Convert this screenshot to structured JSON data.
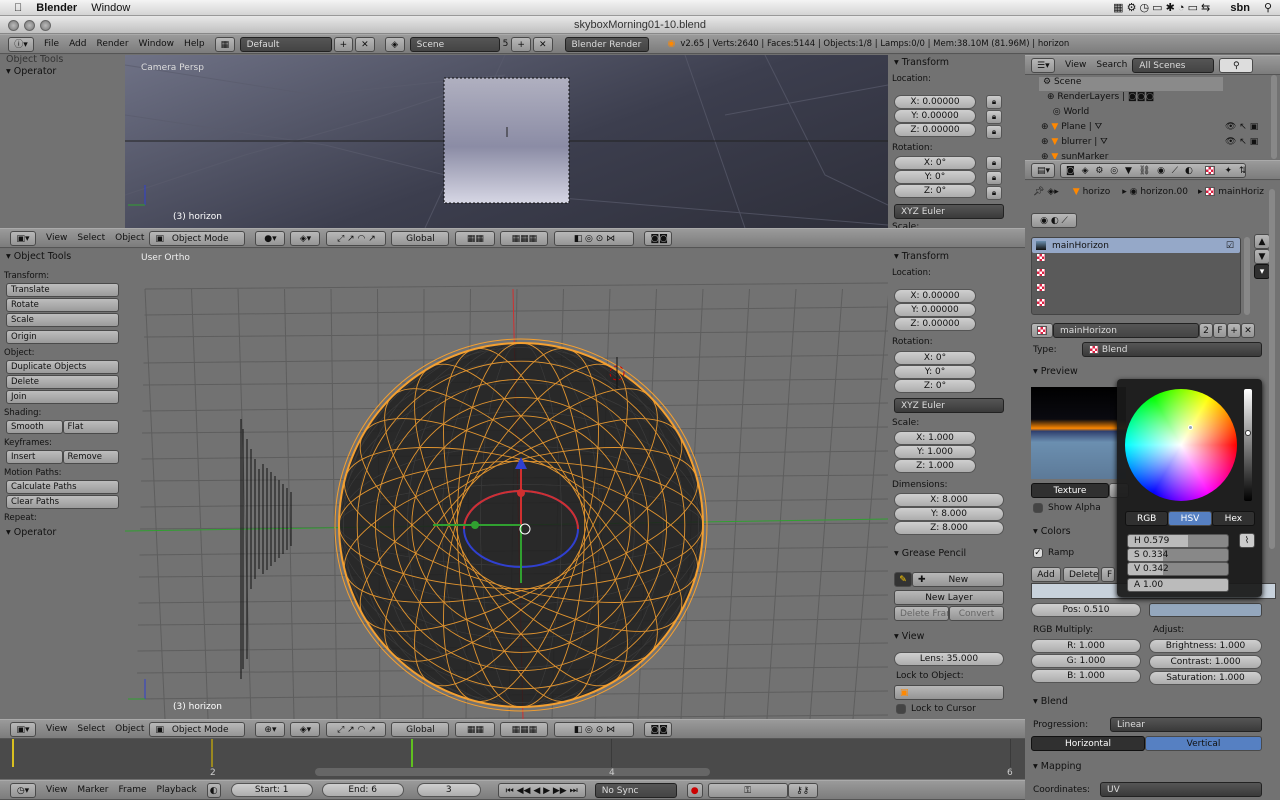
{
  "menubar": {
    "app": "Blender",
    "window": "Window",
    "user": "sbn"
  },
  "window": {
    "title": "skyboxMorning01-10.blend"
  },
  "info_header": {
    "menus": [
      "File",
      "Add",
      "Render",
      "Window",
      "Help"
    ],
    "layout": "Default",
    "scene": "Scene",
    "scene_num": "5",
    "engine": "Blender Render",
    "stats": "v2.65 | Verts:2640 | Faces:5144 | Objects:1/8 | Lamps:0/0 | Mem:38.10M (81.96M) | horizon"
  },
  "top_view": {
    "left_title_a": "Object Tools",
    "left_title_b": "Operator",
    "label": "Camera Persp",
    "obj_label": "(3) horizon",
    "transform": {
      "title": "Transform",
      "location": "Location:",
      "lx": "X: 0.00000",
      "ly": "Y: 0.00000",
      "lz": "Z: 0.00000",
      "rotation": "Rotation:",
      "rx": "X: 0°",
      "ry": "Y: 0°",
      "rz": "Z: 0°",
      "euler": "XYZ Euler",
      "scale": "Scale:"
    }
  },
  "vp_header": {
    "menus": [
      "View",
      "Select",
      "Object"
    ],
    "mode": "Object Mode",
    "orient": "Global"
  },
  "main_view": {
    "label": "User Ortho",
    "obj_label": "(3) horizon"
  },
  "tools": {
    "title": "Object Tools",
    "transform": "Transform:",
    "translate": "Translate",
    "rotate": "Rotate",
    "scale": "Scale",
    "origin": "Origin",
    "object": "Object:",
    "duplicate": "Duplicate Objects",
    "delete": "Delete",
    "join": "Join",
    "shading": "Shading:",
    "smooth": "Smooth",
    "flat": "Flat",
    "keyframes": "Keyframes:",
    "insert": "Insert",
    "remove": "Remove",
    "motion": "Motion Paths:",
    "calc": "Calculate Paths",
    "clear": "Clear Paths",
    "repeat": "Repeat:",
    "operator": "Operator"
  },
  "npanel": {
    "title": "Transform",
    "location": "Location:",
    "lx": "X: 0.00000",
    "ly": "Y: 0.00000",
    "lz": "Z: 0.00000",
    "rotation": "Rotation:",
    "rx": "X: 0°",
    "ry": "Y: 0°",
    "rz": "Z: 0°",
    "euler": "XYZ Euler",
    "scale": "Scale:",
    "sx": "X: 1.000",
    "sy": "Y: 1.000",
    "sz": "Z: 1.000",
    "dimensions": "Dimensions:",
    "dx": "X: 8.000",
    "dy": "Y: 8.000",
    "dz": "Z: 8.000",
    "grease": "Grease Pencil",
    "new": "New",
    "new_layer": "New Layer",
    "delete_frame": "Delete Frame",
    "convert": "Convert",
    "view": "View",
    "lens": "Lens: 35.000",
    "lock_obj": "Lock to Object:",
    "lock_cursor": "Lock to Cursor"
  },
  "outliner": {
    "view": "View",
    "search": "Search",
    "scenes": "All Scenes",
    "items": [
      "Scene",
      "RenderLayers",
      "World",
      "Plane",
      "blurrer",
      "sunMarker"
    ]
  },
  "props": {
    "breadcrumb": [
      "horizo",
      "horizon.00",
      "mainHoriz"
    ],
    "tex_list": [
      "mainHorizon",
      "",
      "",
      "",
      ""
    ],
    "tex_name": "mainHorizon",
    "users": "2",
    "fake": "F",
    "type_label": "Type:",
    "type": "Blend",
    "preview": "Preview",
    "texture_tab": "Texture",
    "show_alpha": "Show Alpha",
    "colors": "Colors",
    "ramp": "Ramp",
    "add": "Add",
    "delete": "Delete",
    "f": "F",
    "pos": "Pos: 0.510",
    "rgb_mult": "RGB Multiply:",
    "adjust": "Adjust:",
    "r": "R: 1.000",
    "g": "G: 1.000",
    "b": "B: 1.000",
    "brightness": "Brightness: 1.000",
    "contrast": "Contrast: 1.000",
    "saturation": "Saturation: 1.000",
    "blend": "Blend",
    "progression_label": "Progression:",
    "progression": "Linear",
    "horizontal": "Horizontal",
    "vertical": "Vertical",
    "mapping": "Mapping",
    "coords_label": "Coordinates:",
    "coords": "UV"
  },
  "picker": {
    "rgb": "RGB",
    "hsv": "HSV",
    "hex": "Hex",
    "h": "H 0.579",
    "s": "S 0.334",
    "v": "V 0.342",
    "a": "A 1.00"
  },
  "timeline": {
    "ticks": [
      "2",
      "4",
      "6"
    ],
    "menus": [
      "View",
      "Marker",
      "Frame",
      "Playback"
    ],
    "start": "Start: 1",
    "end": "End: 6",
    "current": "3",
    "sync": "No Sync"
  },
  "colors": {
    "wire": "#f5a030",
    "axis_x": "#d03030",
    "axis_y": "#30a030",
    "axis_z": "#3040d0",
    "active": "#5680c2"
  }
}
